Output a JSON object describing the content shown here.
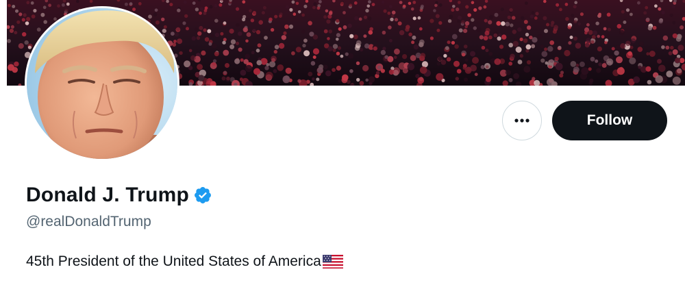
{
  "profile": {
    "display_name": "Donald J. Trump",
    "handle": "@realDonaldTrump",
    "bio": "45th President of the United States of America",
    "verified": true
  },
  "actions": {
    "more_icon": "more-horizontal-icon",
    "follow_label": "Follow"
  },
  "icons": {
    "verified": "verified-badge-icon",
    "flag": "us-flag-emoji"
  },
  "colors": {
    "primary_text": "#0f1419",
    "secondary_text": "#536471",
    "verified_blue": "#1d9bf0",
    "follow_bg": "#0f1419",
    "border": "#cfd9de"
  }
}
